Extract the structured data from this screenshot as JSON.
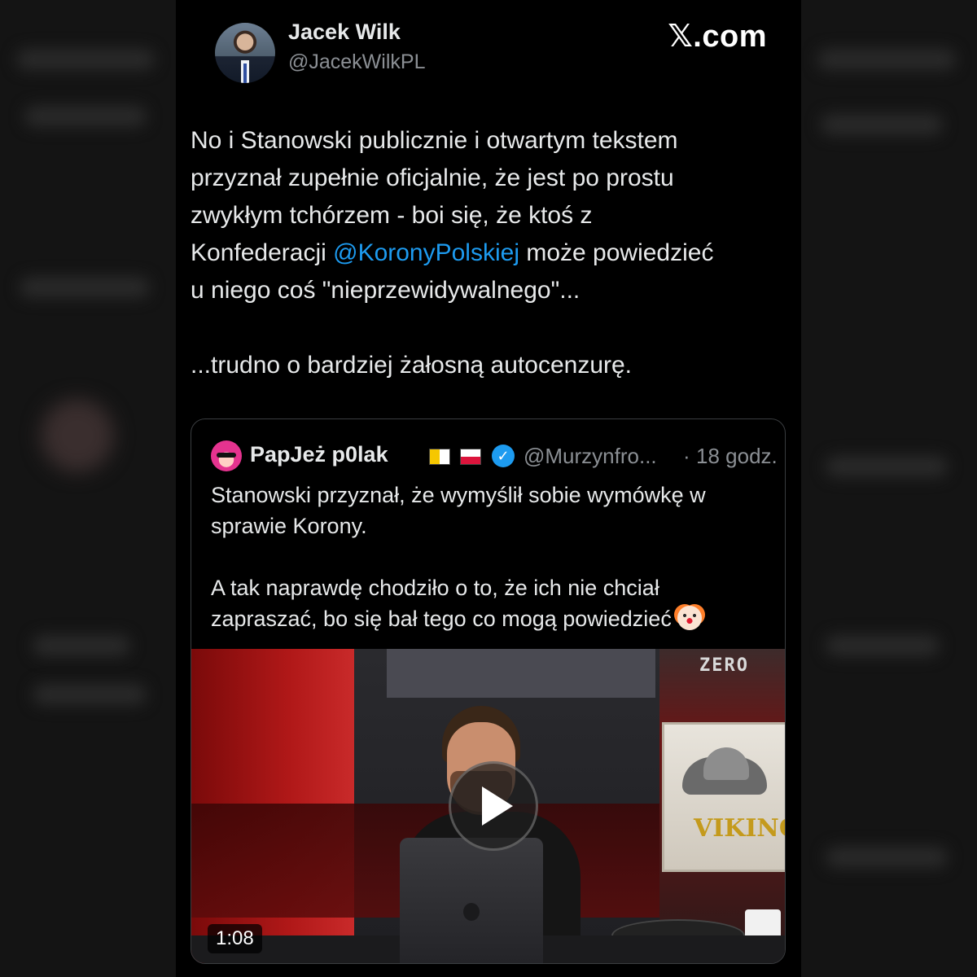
{
  "post": {
    "author_name": "Jacek Wilk",
    "author_handle": "@JacekWilkPL",
    "site_logo": "𝕏.com",
    "text": {
      "line1": "No i Stanowski publicznie i otwartym tekstem",
      "line2": "przyznał zupełnie oficjalnie, że jest po prostu",
      "line3": "zwykłym tchórzem - boi się, że ktoś z",
      "line4_before": "Konfederacji ",
      "mention": "@KoronyPolskiej",
      "line4_after": " może powiedzieć",
      "line5": "u niego coś \"nieprzewidywalnego\"...",
      "line6": "...trudno o bardziej żałosną autocenzurę."
    },
    "colors": {
      "mention": "#1d9bf0",
      "verified": "#1d9bf0"
    }
  },
  "quoted": {
    "display_name": "PapJeż p0lak",
    "flags": [
      "vatican-flag-icon",
      "poland-flag-icon"
    ],
    "verified_icon": "verified-badge-icon",
    "handle": "@Murzynfro...",
    "separator": "·",
    "time": "18 godz.",
    "text": {
      "line1": "Stanowski przyznał, że wymyślił sobie wymówkę w",
      "line2": "sprawie Korony.",
      "line3": "A tak naprawdę chodziło o to, że ich nie chciał",
      "line4": "zapraszać, bo się bał tego co mogą powiedzieć",
      "emoji": "clown-face-icon"
    },
    "video": {
      "duration": "1:08",
      "channel_logo": "ZERO",
      "poster_text": "VIKINGA",
      "play_icon": "play-icon"
    }
  }
}
